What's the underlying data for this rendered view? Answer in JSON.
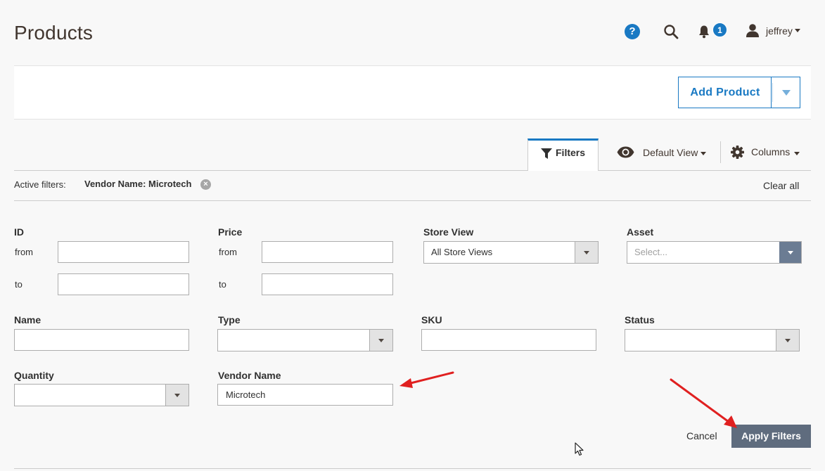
{
  "page": {
    "title": "Products"
  },
  "header": {
    "user_name": "jeffrey",
    "notification_count": "1",
    "help_glyph": "?"
  },
  "action_bar": {
    "add_product_label": "Add Product"
  },
  "toolbar": {
    "filters_label": "Filters",
    "view_label": "Default View",
    "columns_label": "Columns"
  },
  "active_filters": {
    "label": "Active filters:",
    "chip": "Vendor Name: Microtech",
    "remove_glyph": "×",
    "clear_all": "Clear all"
  },
  "filters": {
    "id": {
      "label": "ID",
      "from_label": "from",
      "to_label": "to",
      "from_value": "",
      "to_value": ""
    },
    "price": {
      "label": "Price",
      "from_label": "from",
      "to_label": "to",
      "from_value": "",
      "to_value": ""
    },
    "store_view": {
      "label": "Store View",
      "value": "All Store Views"
    },
    "asset": {
      "label": "Asset",
      "placeholder": "Select..."
    },
    "name": {
      "label": "Name",
      "value": ""
    },
    "type": {
      "label": "Type",
      "value": ""
    },
    "sku": {
      "label": "SKU",
      "value": ""
    },
    "status": {
      "label": "Status",
      "value": ""
    },
    "quantity": {
      "label": "Quantity",
      "value": ""
    },
    "vendor_name": {
      "label": "Vendor Name",
      "value": "Microtech"
    }
  },
  "buttons": {
    "cancel": "Cancel",
    "apply": "Apply Filters"
  },
  "colors": {
    "accent": "#1979c3",
    "apply_button": "#5f6c7e",
    "annotation_arrow": "#e02020"
  },
  "icons": [
    "help-icon",
    "search-icon",
    "bell-icon",
    "user-icon",
    "filter-icon",
    "eye-icon",
    "gear-icon",
    "close-icon",
    "chevron-down-icon",
    "cursor-icon"
  ]
}
